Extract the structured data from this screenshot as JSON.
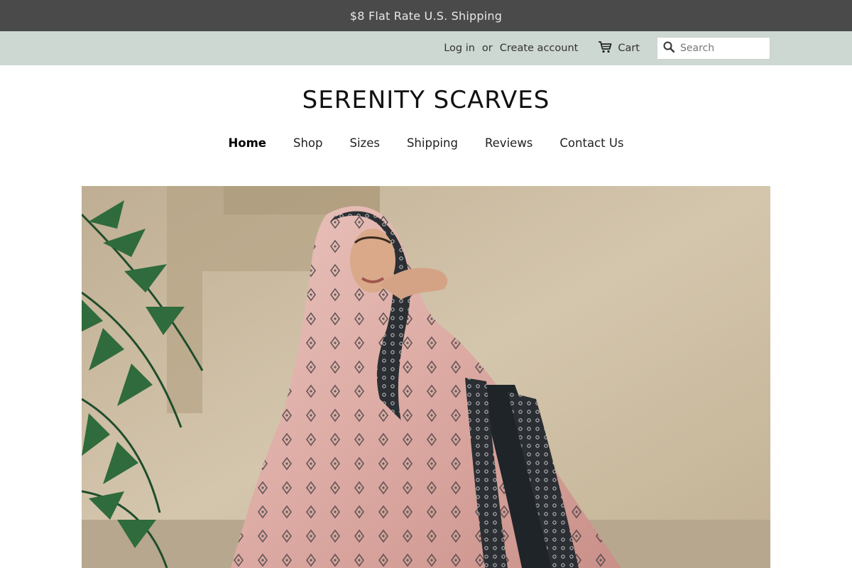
{
  "announcement": {
    "text": "$8 Flat Rate U.S. Shipping"
  },
  "account": {
    "login_label": "Log in",
    "separator": "or",
    "create_label": "Create account",
    "cart_label": "Cart",
    "cart_icon": "cart-icon"
  },
  "search": {
    "placeholder": "Search",
    "icon": "search-icon"
  },
  "brand": {
    "title": "SERENITY SCARVES"
  },
  "nav": {
    "items": [
      {
        "label": "Home",
        "active": true
      },
      {
        "label": "Shop",
        "active": false
      },
      {
        "label": "Sizes",
        "active": false
      },
      {
        "label": "Shipping",
        "active": false
      },
      {
        "label": "Reviews",
        "active": false
      },
      {
        "label": "Contact Us",
        "active": false
      }
    ]
  },
  "colors": {
    "announcement_bg": "#4a4a4a",
    "topbar_bg": "#cdd8d2",
    "scarf_pink": "#e0b3ad",
    "scarf_border": "#2b2f33",
    "wall": "#c9b99f"
  }
}
